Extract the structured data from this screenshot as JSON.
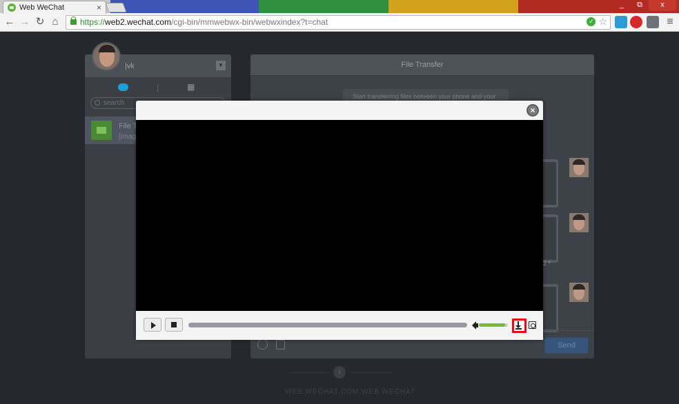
{
  "browser": {
    "tab_title": "Web WeChat",
    "tab_close": "×",
    "url_scheme": "https://",
    "url_host": "web2.wechat.com",
    "url_path": "/cgi-bin/mmwebwx-bin/webwxindex?t=chat",
    "back": "←",
    "forward": "→",
    "reload": "↻",
    "home": "⌂",
    "menu": "≡",
    "window_minimize": "_",
    "window_restore": "⧉",
    "window_close": "x",
    "stripe_colors": [
      "#3d56b6",
      "#2f8f3c",
      "#d3a21d",
      "#b32a22"
    ]
  },
  "sidebar": {
    "username": "|vk",
    "search_placeholder": "search",
    "chat_item": {
      "title": "File T",
      "subtitle": "[Imag"
    }
  },
  "chat": {
    "title": "File Transfer",
    "system_message": "Start transferring files between your phone and your",
    "partial_text": "2 *",
    "send_label": "Send"
  },
  "modal": {
    "close_glyph": "×"
  },
  "player": {
    "progress": 0,
    "volume": 0.9
  },
  "footer": {
    "watermark": "WEB.WECHAT.COM   WEB WECHAT"
  },
  "colors": {
    "wechat_green": "#7dbb2c",
    "highlight_red": "#e30e16",
    "send_blue": "#37557a"
  }
}
